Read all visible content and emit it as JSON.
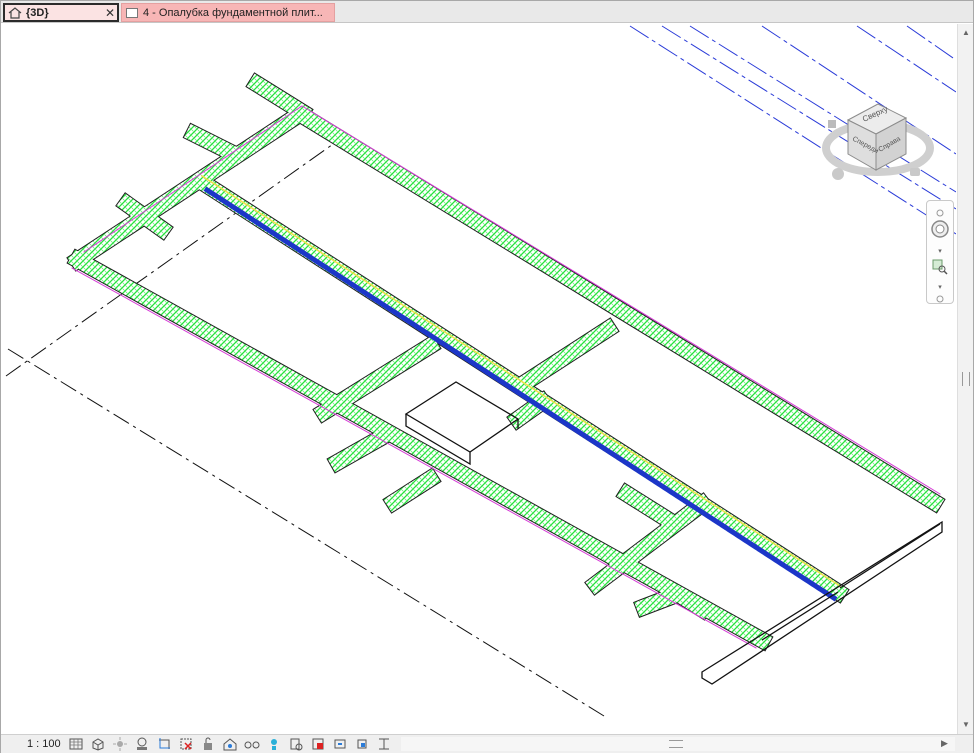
{
  "tabs": [
    {
      "label": "{3D}",
      "icon": "home-icon",
      "active": true,
      "close": "✕"
    },
    {
      "label": "4 - Опалубка фундаментной плит...",
      "icon": "sheet-icon",
      "active": false
    }
  ],
  "viewcube": {
    "top": "Сверху",
    "left_face": "Спереди",
    "right_face": "Справа"
  },
  "navbar": {
    "items": [
      "steering-wheel-icon",
      "zoom-icon"
    ]
  },
  "statusbar": {
    "scale": "1 : 100",
    "tools": [
      "detail-level-icon",
      "visual-style-icon",
      "sun-path-icon",
      "shadows-icon",
      "crop-view-icon",
      "show-crop-icon",
      "unlock-3d-icon",
      "temporary-hide-icon",
      "reveal-hidden-icon",
      "worksharing-icon",
      "analytical-model-icon",
      "highlight-boundaries-icon",
      "constraints-icon",
      "reveal-constraints-icon",
      "displacement-icon",
      "temporary-view-properties-icon"
    ]
  },
  "colors": {
    "rebar": "#22e33a",
    "rebar_magenta": "#d63bd6",
    "rebar_blue": "#1c36c8",
    "axis_blue": "#2a3bd8",
    "tab_pink": "#f7b6b6"
  }
}
